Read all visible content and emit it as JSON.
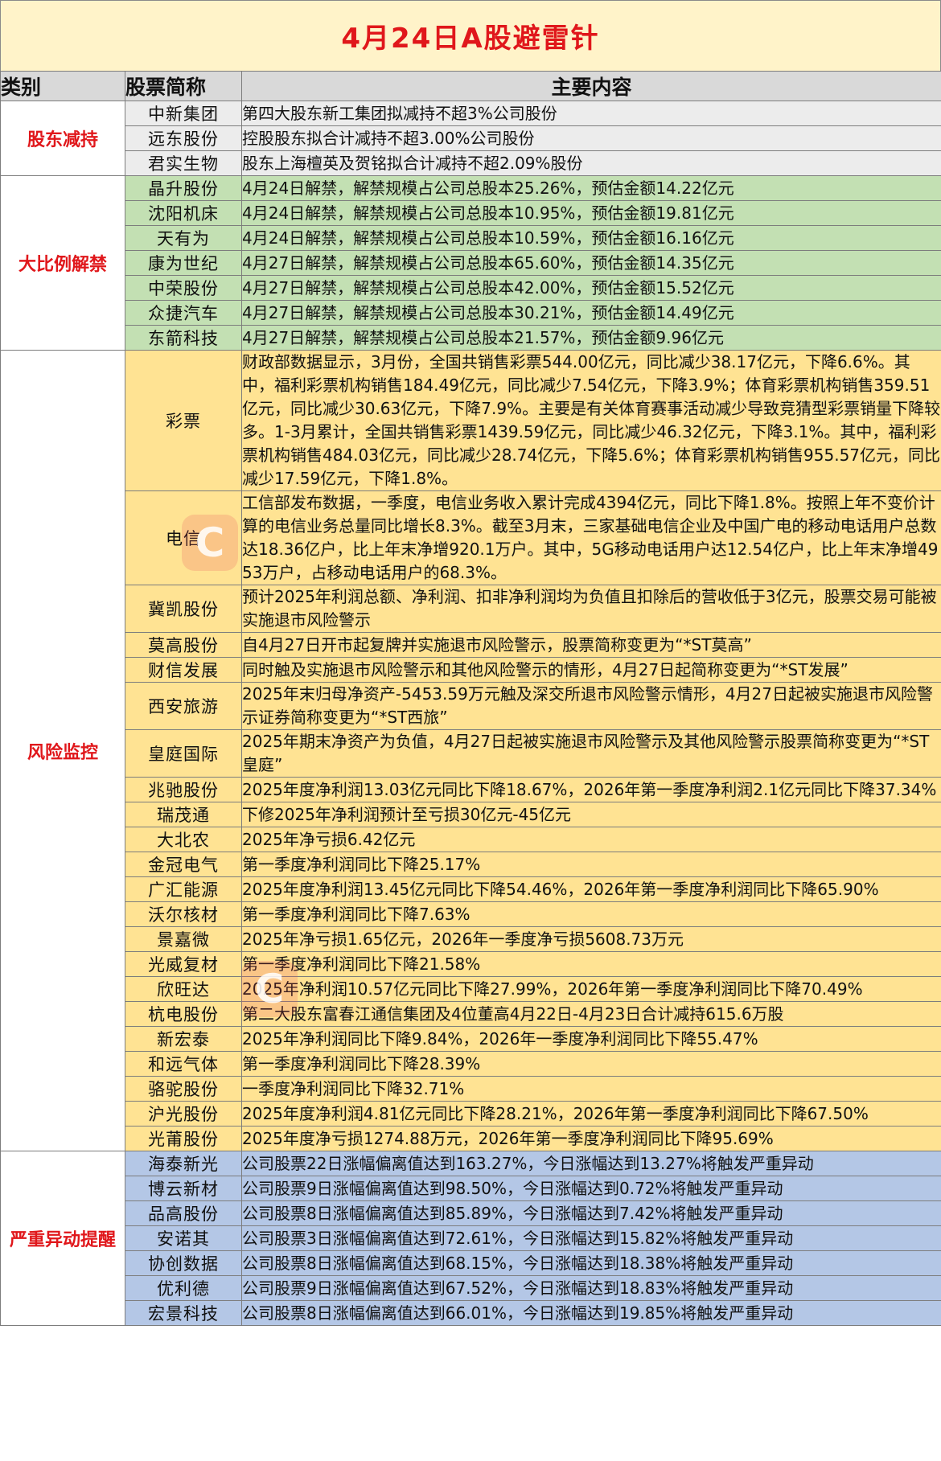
{
  "title": "4月24日A股避雷针",
  "headers": {
    "category": "类别",
    "name": "股票简称",
    "content": "主要内容"
  },
  "colors": {
    "title_bg": "#fff3c9",
    "title_text": "#e0171b",
    "header_bg": "#d9d9d9",
    "group_grey": "#ececec",
    "group_green": "#c3e0b3",
    "group_yellow": "#ffe393",
    "group_blue": "#b4c7e6"
  },
  "groups": [
    {
      "category": "股东减持",
      "rows": [
        {
          "name": "中新集团",
          "content": "第四大股东新工集团拟减持不超3%公司股份"
        },
        {
          "name": "远东股份",
          "content": "控股股东拟合计减持不超3.00%公司股份"
        },
        {
          "name": "君实生物",
          "content": "股东上海檀英及贺铭拟合计减持不超2.09%股份"
        }
      ]
    },
    {
      "category": "大比例解禁",
      "rows": [
        {
          "name": "晶升股份",
          "content": "4月24日解禁，解禁规模占公司总股本25.26%，预估金额14.22亿元"
        },
        {
          "name": "沈阳机床",
          "content": "4月24日解禁，解禁规模占公司总股本10.95%，预估金额19.81亿元"
        },
        {
          "name": "天有为",
          "content": "4月24日解禁，解禁规模占公司总股本10.59%，预估金额16.16亿元"
        },
        {
          "name": "康为世纪",
          "content": "4月27日解禁，解禁规模占公司总股本65.60%，预估金额14.35亿元"
        },
        {
          "name": "中荣股份",
          "content": "4月27日解禁，解禁规模占公司总股本42.00%，预估金额15.52亿元"
        },
        {
          "name": "众捷汽车",
          "content": "4月27日解禁，解禁规模占公司总股本30.21%，预估金额14.49亿元"
        },
        {
          "name": "东箭科技",
          "content": "4月27日解禁，解禁规模占公司总股本21.57%，预估金额9.96亿元"
        }
      ]
    },
    {
      "category": "风险监控",
      "rows": [
        {
          "name": "彩票",
          "content": "财政部数据显示，3月份，全国共销售彩票544.00亿元，同比减少38.17亿元，下降6.6%。其中，福利彩票机构销售184.49亿元，同比减少7.54亿元，下降3.9%；体育彩票机构销售359.51亿元，同比减少30.63亿元，下降7.9%。主要是有关体育赛事活动减少导致竞猜型彩票销量下降较多。1-3月累计，全国共销售彩票1439.59亿元，同比减少46.32亿元，下降3.1%。其中，福利彩票机构销售484.03亿元，同比减少28.74亿元，下降5.6%；体育彩票机构销售955.57亿元，同比减少17.59亿元，下降1.8%。"
        },
        {
          "name": "电信",
          "content": "工信部发布数据，一季度，电信业务收入累计完成4394亿元，同比下降1.8%。按照上年不变价计算的电信业务总量同比增长8.3%。截至3月末，三家基础电信企业及中国广电的移动电话用户总数达18.36亿户，比上年末净增920.1万户。其中，5G移动电话用户达12.54亿户，比上年末净增4953万户，占移动电话用户的68.3%。"
        },
        {
          "name": "冀凯股份",
          "content": "预计2025年利润总额、净利润、扣非净利润均为负值且扣除后的营收低于3亿元，股票交易可能被实施退市风险警示"
        },
        {
          "name": "莫高股份",
          "content": "自4月27日开市起复牌并实施退市风险警示，股票简称变更为“*ST莫高”"
        },
        {
          "name": "财信发展",
          "content": "同时触及实施退市风险警示和其他风险警示的情形，4月27日起简称变更为“*ST发展”"
        },
        {
          "name": "西安旅游",
          "content": "2025年末归母净资产-5453.59万元触及深交所退市风险警示情形，4月27日起被实施退市风险警示证券简称变更为“*ST西旅”"
        },
        {
          "name": "皇庭国际",
          "content": "2025年期末净资产为负值，4月27日起被实施退市风险警示及其他风险警示股票简称变更为“*ST皇庭”"
        },
        {
          "name": "兆驰股份",
          "content": "2025年度净利润13.03亿元同比下降18.67%，2026年第一季度净利润2.1亿元同比下降37.34%"
        },
        {
          "name": "瑞茂通",
          "content": "下修2025年净利润预计至亏损30亿元-45亿元"
        },
        {
          "name": "大北农",
          "content": "2025年净亏损6.42亿元"
        },
        {
          "name": "金冠电气",
          "content": "第一季度净利润同比下降25.17%"
        },
        {
          "name": "广汇能源",
          "content": "2025年度净利润13.45亿元同比下降54.46%，2026年第一季度净利润同比下降65.90%"
        },
        {
          "name": "沃尔核材",
          "content": "第一季度净利润同比下降7.63%"
        },
        {
          "name": "景嘉微",
          "content": "2025年净亏损1.65亿元，2026年一季度净亏损5608.73万元"
        },
        {
          "name": "光威复材",
          "content": "第一季度净利润同比下降21.58%"
        },
        {
          "name": "欣旺达",
          "content": "2025年净利润10.57亿元同比下降27.99%，2026年第一季度净利润同比下降70.49%"
        },
        {
          "name": "杭电股份",
          "content": "第二大股东富春江通信集团及4位董高4月22日-4月23日合计减持615.6万股"
        },
        {
          "name": "新宏泰",
          "content": "2025年净利润同比下降9.84%，2026年一季度净利润同比下降55.47%"
        },
        {
          "name": "和远气体",
          "content": "第一季度净利润同比下降28.39%"
        },
        {
          "name": "骆驼股份",
          "content": "一季度净利润同比下降32.71%"
        },
        {
          "name": "沪光股份",
          "content": "2025年度净利润4.81亿元同比下降28.21%，2026年第一季度净利润同比下降67.50%"
        },
        {
          "name": "光莆股份",
          "content": "2025年度净亏损1274.88万元，2026年第一季度净利润同比下降95.69%"
        }
      ]
    },
    {
      "category": "严重异动提醒",
      "rows": [
        {
          "name": "海泰新光",
          "content": "公司股票22日涨幅偏离值达到163.27%，今日涨幅达到13.27%将触发严重异动"
        },
        {
          "name": "博云新材",
          "content": "公司股票9日涨幅偏离值达到98.50%，今日涨幅达到0.72%将触发严重异动"
        },
        {
          "name": "品高股份",
          "content": "公司股票8日涨幅偏离值达到85.89%，今日涨幅达到7.42%将触发严重异动"
        },
        {
          "name": "安诺其",
          "content": "公司股票3日涨幅偏离值达到72.61%，今日涨幅达到15.82%将触发严重异动"
        },
        {
          "name": "协创数据",
          "content": "公司股票8日涨幅偏离值达到68.15%，今日涨幅达到18.38%将触发严重异动"
        },
        {
          "name": "优利德",
          "content": "公司股票9日涨幅偏离值达到67.52%，今日涨幅达到18.83%将触发严重异动"
        },
        {
          "name": "宏景科技",
          "content": "公司股票8日涨幅偏离值达到66.01%，今日涨幅达到19.85%将触发严重异动"
        }
      ]
    }
  ]
}
